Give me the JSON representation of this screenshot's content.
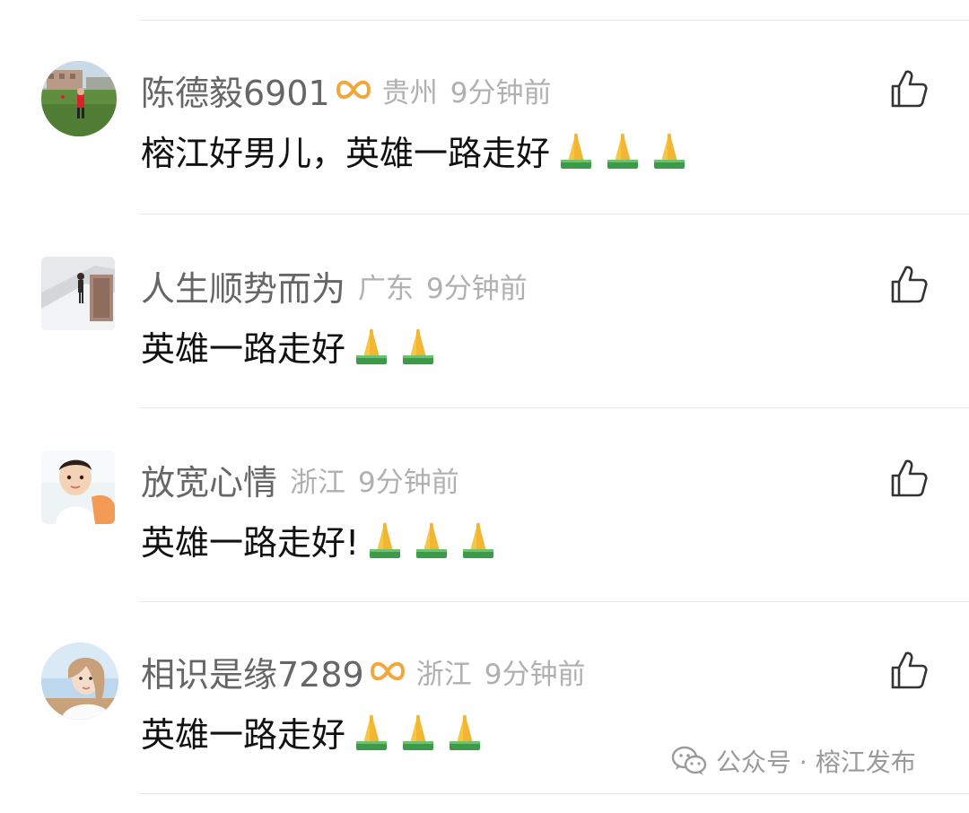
{
  "comments": [
    {
      "name": "陈德毅6901",
      "has_badge": true,
      "region": "贵州",
      "time": "9分钟前",
      "text": "榕江好男儿，英雄一路走好",
      "emoji_count": 3
    },
    {
      "name": "人生顺势而为",
      "has_badge": false,
      "region": "广东",
      "time": "9分钟前",
      "text": "英雄一路走好",
      "emoji_count": 2
    },
    {
      "name": "放宽心情",
      "has_badge": false,
      "region": "浙江",
      "time": "9分钟前",
      "text": "英雄一路走好!",
      "emoji_count": 3
    },
    {
      "name": "相识是缘7289",
      "has_badge": true,
      "region": "浙江",
      "time": "9分钟前",
      "text": "英雄一路走好",
      "emoji_count": 3
    }
  ],
  "watermark": {
    "text": "公众号 · 榕江发布",
    "icon": "wechat-icon"
  },
  "icons": {
    "like": "thumbs-up-icon",
    "badge": "infinity-badge-icon",
    "emoji": "folded-hands-emoji"
  },
  "colors": {
    "name": "#666666",
    "meta": "#b0b0b0",
    "text": "#111111",
    "badge": "#f0a83c",
    "divider": "#e8e8e8"
  }
}
